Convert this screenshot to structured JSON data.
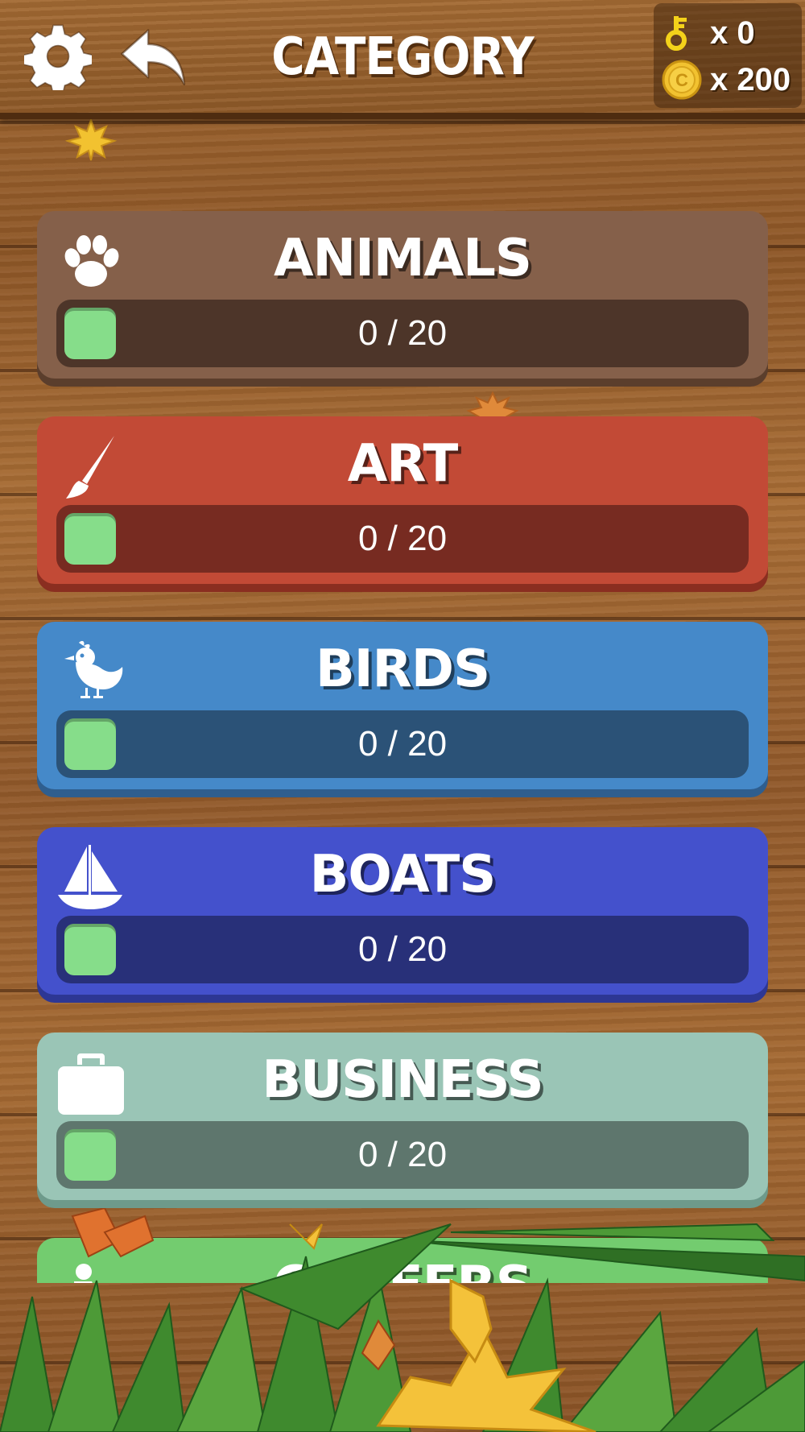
{
  "header": {
    "title": "CATEGORY",
    "settings_icon": "gear-icon",
    "back_icon": "back-arrow-icon"
  },
  "currency": {
    "keys": {
      "icon": "key-icon",
      "label": "x 0"
    },
    "coins": {
      "icon": "coin-icon",
      "coin_letter": "C",
      "label": "x 200"
    }
  },
  "categories": [
    {
      "name": "ANIMALS",
      "icon": "paw-icon",
      "progress_text": "0 / 20",
      "completed": 0,
      "total": 20,
      "color": "#85604a",
      "bar_color": "#4d3529"
    },
    {
      "name": "ART",
      "icon": "paintbrush-icon",
      "progress_text": "0 / 20",
      "completed": 0,
      "total": 20,
      "color": "#c24a36",
      "bar_color": "#772b21"
    },
    {
      "name": "BIRDS",
      "icon": "bird-icon",
      "progress_text": "0 / 20",
      "completed": 0,
      "total": 20,
      "color": "#4589c9",
      "bar_color": "#2b5277"
    },
    {
      "name": "BOATS",
      "icon": "sailboat-icon",
      "progress_text": "0 / 20",
      "completed": 0,
      "total": 20,
      "color": "#4451cc",
      "bar_color": "#283079"
    },
    {
      "name": "BUSINESS",
      "icon": "briefcase-icon",
      "progress_text": "0 / 20",
      "completed": 0,
      "total": 20,
      "color": "#9ac5b6",
      "bar_color": "#5e766d"
    },
    {
      "name": "CAREERS",
      "icon": "worker-icon",
      "color": "#73cc6f"
    }
  ],
  "colors": {
    "progress_fill": "#86dd8a",
    "coin_gold": "#f2c230",
    "key_gold": "#f4d21a"
  }
}
